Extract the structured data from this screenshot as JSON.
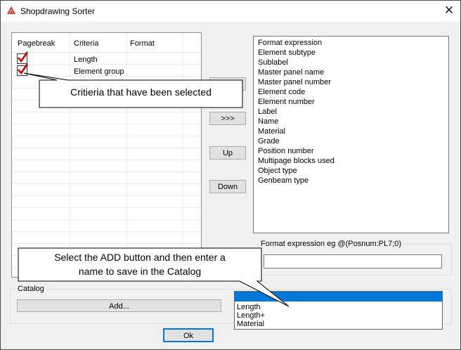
{
  "window": {
    "title": "Shopdrawing Sorter",
    "close_glyph": "✕"
  },
  "grid": {
    "columns": [
      "Pagebreak",
      "Criteria",
      "Format"
    ],
    "rows": [
      {
        "pagebreak": true,
        "criteria": "Length",
        "format": ""
      },
      {
        "pagebreak": true,
        "criteria": "Element group",
        "format": ""
      }
    ]
  },
  "buttons": {
    "remove": "<<<",
    "add_criteria": ">>>",
    "up": "Up",
    "down": "Down",
    "catalog_add": "Add...",
    "ok": "Ok"
  },
  "available": [
    "Format expression",
    "Element subtype",
    "Sublabel",
    "Master panel name",
    "Master panel number",
    "Element code",
    "Element number",
    "Label",
    "Name",
    "Material",
    "Grade",
    "Position number",
    "Multipage blocks used",
    "Object type",
    "Genbeam type"
  ],
  "format_group": {
    "label": "Format expression eg @(Posnum:PL7;0)",
    "value": ""
  },
  "catalog": {
    "label": "Catalog",
    "selected": "",
    "options": [
      "Length",
      "Length+",
      "Material"
    ]
  },
  "callouts": {
    "criteria": "Critieria that have been selected",
    "catalog_line1": "Select the ADD button and then enter a",
    "catalog_line2": "name to save in the Catalog"
  },
  "icons": {
    "app": "shopdrawing-app-icon",
    "check": "red-check-icon",
    "dropdown": "chevron-down-icon"
  },
  "colors": {
    "check": "#d40000",
    "highlight": "#0078d7",
    "combo_bg": "#e5f1fb"
  }
}
